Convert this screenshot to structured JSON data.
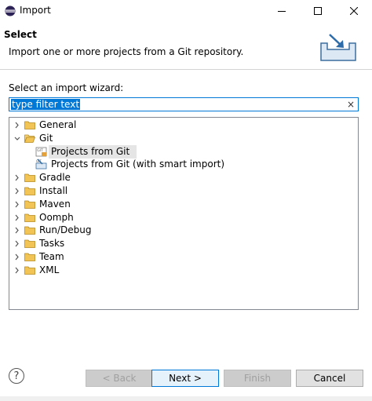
{
  "window": {
    "title": "Import",
    "minimize_icon": "minimize-icon",
    "maximize_icon": "maximize-icon",
    "close_icon": "close-icon"
  },
  "header": {
    "title": "Select",
    "description": "Import one or more projects from a Git repository.",
    "banner_icon": "import-wizard-icon"
  },
  "wizard": {
    "label": "Select an import wizard:",
    "filter_value": "type filter text",
    "clear_icon": "×"
  },
  "tree": [
    {
      "label": "General",
      "expanded": false,
      "level": 0,
      "type": "folder"
    },
    {
      "label": "Git",
      "expanded": true,
      "level": 0,
      "type": "folder"
    },
    {
      "label": "Projects from Git",
      "level": 1,
      "type": "git-icon",
      "selected": true
    },
    {
      "label": "Projects from Git (with smart import)",
      "level": 1,
      "type": "smart-import-icon"
    },
    {
      "label": "Gradle",
      "expanded": false,
      "level": 0,
      "type": "folder"
    },
    {
      "label": "Install",
      "expanded": false,
      "level": 0,
      "type": "folder"
    },
    {
      "label": "Maven",
      "expanded": false,
      "level": 0,
      "type": "folder"
    },
    {
      "label": "Oomph",
      "expanded": false,
      "level": 0,
      "type": "folder"
    },
    {
      "label": "Run/Debug",
      "expanded": false,
      "level": 0,
      "type": "folder"
    },
    {
      "label": "Tasks",
      "expanded": false,
      "level": 0,
      "type": "folder"
    },
    {
      "label": "Team",
      "expanded": false,
      "level": 0,
      "type": "folder"
    },
    {
      "label": "XML",
      "expanded": false,
      "level": 0,
      "type": "folder"
    }
  ],
  "buttons": {
    "help": "?",
    "back": "< Back",
    "next": "Next >",
    "finish": "Finish",
    "cancel": "Cancel"
  },
  "colors": {
    "accent": "#0078d7",
    "folder": "#e8b84a",
    "selection": "#e5e5e5"
  }
}
